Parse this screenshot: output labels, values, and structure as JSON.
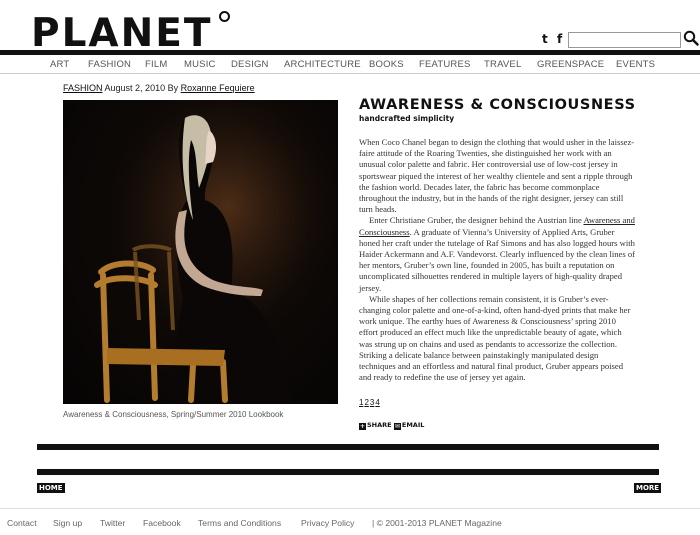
{
  "header": {
    "logo_text": "PLANET",
    "social": {
      "twitter": "t",
      "facebook": "f"
    },
    "search": {
      "value": "",
      "placeholder": ""
    }
  },
  "nav": {
    "items": [
      "ART",
      "FASHION",
      "FILM",
      "MUSIC",
      "DESIGN",
      "ARCHITECTURE",
      "BOOKS",
      "FEATURES",
      "TRAVEL",
      "GREENSPACE",
      "EVENTS"
    ]
  },
  "byline": {
    "category": "FASHION",
    "date": "August 2, 2010",
    "by": "By",
    "author": "Roxanne Fequiere"
  },
  "article": {
    "title": "AWARENESS & CONSCIOUSNESS",
    "subtitle": "handcrafted simplicity",
    "p1": "When Coco Chanel began to design the clothing that would usher in the laissez-faire attitude of the Roaring Twenties, she distinguished her work with an unusual color palette and fabric. Her controversial use of low-cost jersey in sportswear piqued the interest of her wealthy clientele and sent a ripple through the fashion world. Decades later, the fabric has become commonplace throughout the industry, but in the hands of the right designer, jersey can still turn heads.",
    "p2_before": "Enter Christiane Gruber, the designer behind the Austrian line ",
    "p2_link": "Awareness and Consciousness",
    "p2_after": ". A graduate of Vienna’s University of Applied Arts, Gruber honed her craft under the tutelage of Raf Simons and has also logged hours with Haider Ackermann and A.F. Vandevorst. Clearly influenced by the clean lines of her mentors, Gruber’s own line, founded in  2005, has built a reputation on uncomplicated silhouettes rendered in multiple layers of high-quality draped jersey.",
    "p3": "While shapes of her collections remain consistent, it is Gruber’s ever-changing color palette and one-of-a-kind, often hand-dyed prints that make her work unique. The earthy hues of Awareness & Consciousness’ spring 2010 effort produced an effect much like the unpredictable beauty of agate, which was strung up on chains and used as pendants to accessorize the collection. Striking a delicate balance between painstakingly manipulated design techniques and an effortless and natural final product, Gruber appears poised and ready to redefine the use of jersey yet again.",
    "pages": [
      "1",
      "2",
      "3",
      "4"
    ],
    "share_label": "SHARE",
    "email_label": "EMAIL"
  },
  "photo": {
    "caption": "Awareness & Consciousness, Spring/Summer 2010 Lookbook"
  },
  "bottom": {
    "home_label": "HOME",
    "more_label": "MORE"
  },
  "footer": {
    "links": [
      "Contact",
      "Sign up",
      "Twitter",
      "Facebook",
      "Terms and Conditions",
      "Privacy Policy"
    ],
    "copyright": "| © 2001-2013 PLANET Magazine"
  },
  "colors": {
    "ink": "#111111",
    "nav_text": "#555555",
    "body_text": "#333333"
  }
}
